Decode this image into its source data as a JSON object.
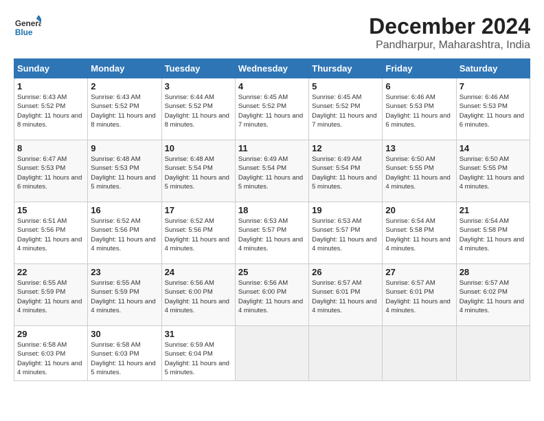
{
  "header": {
    "logo_general": "General",
    "logo_blue": "Blue",
    "title": "December 2024",
    "subtitle": "Pandharpur, Maharashtra, India"
  },
  "calendar": {
    "days_of_week": [
      "Sunday",
      "Monday",
      "Tuesday",
      "Wednesday",
      "Thursday",
      "Friday",
      "Saturday"
    ],
    "weeks": [
      [
        {
          "day": "1",
          "info": "Sunrise: 6:43 AM\nSunset: 5:52 PM\nDaylight: 11 hours and 8 minutes."
        },
        {
          "day": "2",
          "info": "Sunrise: 6:43 AM\nSunset: 5:52 PM\nDaylight: 11 hours and 8 minutes."
        },
        {
          "day": "3",
          "info": "Sunrise: 6:44 AM\nSunset: 5:52 PM\nDaylight: 11 hours and 8 minutes."
        },
        {
          "day": "4",
          "info": "Sunrise: 6:45 AM\nSunset: 5:52 PM\nDaylight: 11 hours and 7 minutes."
        },
        {
          "day": "5",
          "info": "Sunrise: 6:45 AM\nSunset: 5:52 PM\nDaylight: 11 hours and 7 minutes."
        },
        {
          "day": "6",
          "info": "Sunrise: 6:46 AM\nSunset: 5:53 PM\nDaylight: 11 hours and 6 minutes."
        },
        {
          "day": "7",
          "info": "Sunrise: 6:46 AM\nSunset: 5:53 PM\nDaylight: 11 hours and 6 minutes."
        }
      ],
      [
        {
          "day": "8",
          "info": "Sunrise: 6:47 AM\nSunset: 5:53 PM\nDaylight: 11 hours and 6 minutes."
        },
        {
          "day": "9",
          "info": "Sunrise: 6:48 AM\nSunset: 5:53 PM\nDaylight: 11 hours and 5 minutes."
        },
        {
          "day": "10",
          "info": "Sunrise: 6:48 AM\nSunset: 5:54 PM\nDaylight: 11 hours and 5 minutes."
        },
        {
          "day": "11",
          "info": "Sunrise: 6:49 AM\nSunset: 5:54 PM\nDaylight: 11 hours and 5 minutes."
        },
        {
          "day": "12",
          "info": "Sunrise: 6:49 AM\nSunset: 5:54 PM\nDaylight: 11 hours and 5 minutes."
        },
        {
          "day": "13",
          "info": "Sunrise: 6:50 AM\nSunset: 5:55 PM\nDaylight: 11 hours and 4 minutes."
        },
        {
          "day": "14",
          "info": "Sunrise: 6:50 AM\nSunset: 5:55 PM\nDaylight: 11 hours and 4 minutes."
        }
      ],
      [
        {
          "day": "15",
          "info": "Sunrise: 6:51 AM\nSunset: 5:56 PM\nDaylight: 11 hours and 4 minutes."
        },
        {
          "day": "16",
          "info": "Sunrise: 6:52 AM\nSunset: 5:56 PM\nDaylight: 11 hours and 4 minutes."
        },
        {
          "day": "17",
          "info": "Sunrise: 6:52 AM\nSunset: 5:56 PM\nDaylight: 11 hours and 4 minutes."
        },
        {
          "day": "18",
          "info": "Sunrise: 6:53 AM\nSunset: 5:57 PM\nDaylight: 11 hours and 4 minutes."
        },
        {
          "day": "19",
          "info": "Sunrise: 6:53 AM\nSunset: 5:57 PM\nDaylight: 11 hours and 4 minutes."
        },
        {
          "day": "20",
          "info": "Sunrise: 6:54 AM\nSunset: 5:58 PM\nDaylight: 11 hours and 4 minutes."
        },
        {
          "day": "21",
          "info": "Sunrise: 6:54 AM\nSunset: 5:58 PM\nDaylight: 11 hours and 4 minutes."
        }
      ],
      [
        {
          "day": "22",
          "info": "Sunrise: 6:55 AM\nSunset: 5:59 PM\nDaylight: 11 hours and 4 minutes."
        },
        {
          "day": "23",
          "info": "Sunrise: 6:55 AM\nSunset: 5:59 PM\nDaylight: 11 hours and 4 minutes."
        },
        {
          "day": "24",
          "info": "Sunrise: 6:56 AM\nSunset: 6:00 PM\nDaylight: 11 hours and 4 minutes."
        },
        {
          "day": "25",
          "info": "Sunrise: 6:56 AM\nSunset: 6:00 PM\nDaylight: 11 hours and 4 minutes."
        },
        {
          "day": "26",
          "info": "Sunrise: 6:57 AM\nSunset: 6:01 PM\nDaylight: 11 hours and 4 minutes."
        },
        {
          "day": "27",
          "info": "Sunrise: 6:57 AM\nSunset: 6:01 PM\nDaylight: 11 hours and 4 minutes."
        },
        {
          "day": "28",
          "info": "Sunrise: 6:57 AM\nSunset: 6:02 PM\nDaylight: 11 hours and 4 minutes."
        }
      ],
      [
        {
          "day": "29",
          "info": "Sunrise: 6:58 AM\nSunset: 6:03 PM\nDaylight: 11 hours and 4 minutes."
        },
        {
          "day": "30",
          "info": "Sunrise: 6:58 AM\nSunset: 6:03 PM\nDaylight: 11 hours and 5 minutes."
        },
        {
          "day": "31",
          "info": "Sunrise: 6:59 AM\nSunset: 6:04 PM\nDaylight: 11 hours and 5 minutes."
        },
        {
          "day": "",
          "info": ""
        },
        {
          "day": "",
          "info": ""
        },
        {
          "day": "",
          "info": ""
        },
        {
          "day": "",
          "info": ""
        }
      ]
    ]
  }
}
